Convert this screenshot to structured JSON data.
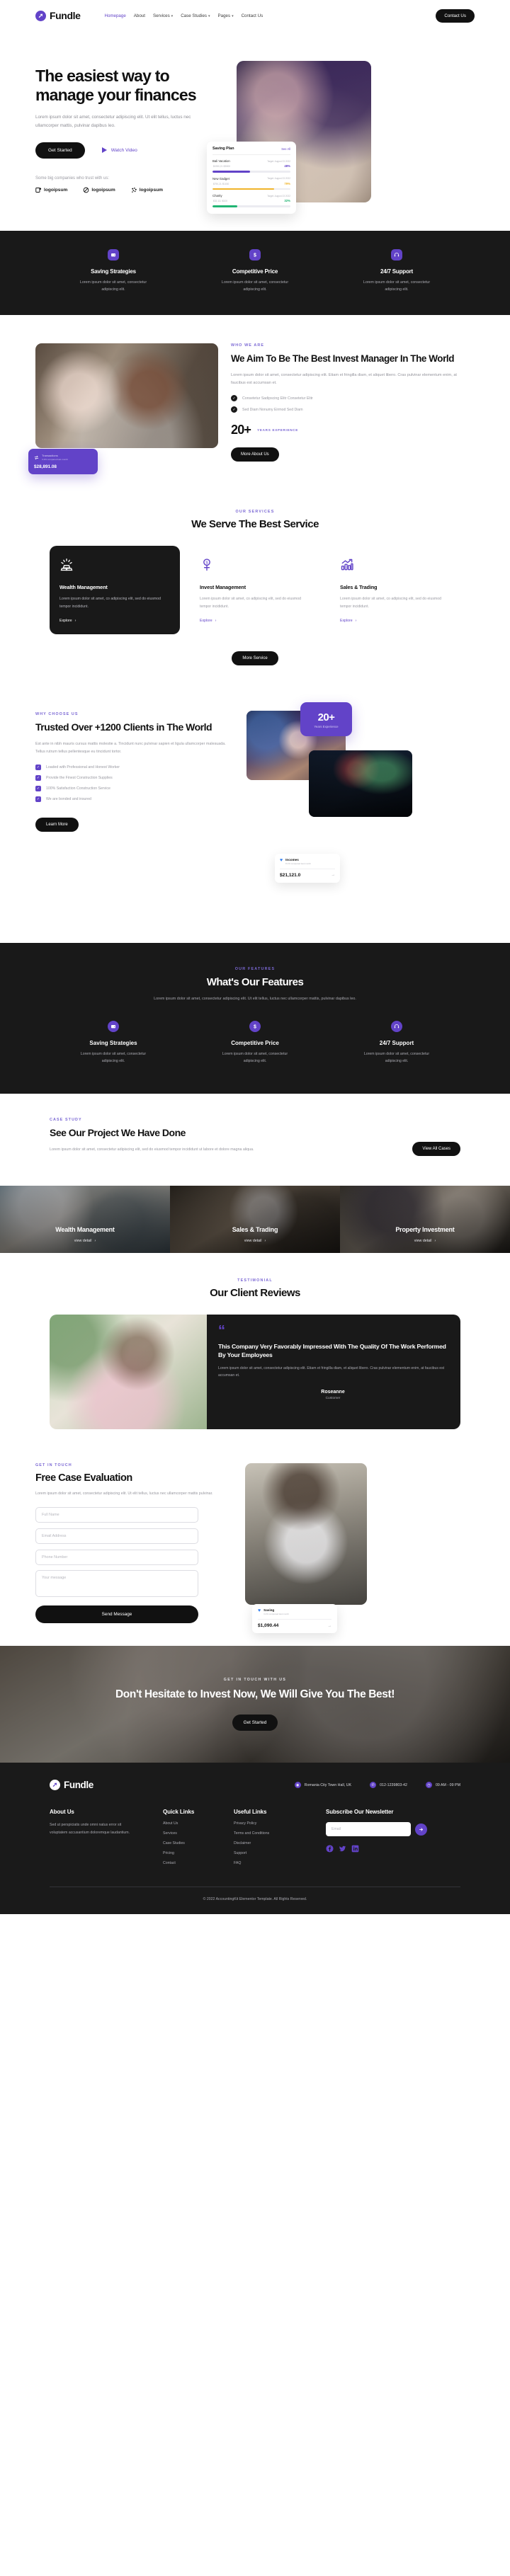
{
  "header": {
    "brand": "Fundle",
    "nav": [
      {
        "label": "Homepage",
        "active": true,
        "caret": false
      },
      {
        "label": "About",
        "active": false,
        "caret": false
      },
      {
        "label": "Services",
        "active": false,
        "caret": true
      },
      {
        "label": "Case Studies",
        "active": false,
        "caret": true
      },
      {
        "label": "Pages",
        "active": false,
        "caret": true
      },
      {
        "label": "Contact Us",
        "active": false,
        "caret": false
      }
    ],
    "cta_label": "Contact Us"
  },
  "hero": {
    "title": "The easiest way to manage your finances",
    "subtitle": "Lorem ipsum dolor sit amet, consectetur adipiscing elit. Ut elit tellus, luctus nec ullamcorper mattis, pulvinar dapibus leo.",
    "primary_btn": "Get Started",
    "secondary_btn": "Watch Video",
    "trust_label": "Some big companies who trust with us:",
    "logos": [
      "logoipsum",
      "logoipsum",
      "logoipsum"
    ],
    "saving_card": {
      "title": "Saving Plan",
      "see_all": "See All",
      "rows": [
        {
          "name": "Bali Vacation",
          "target": "Target: August 23 2022",
          "amount": "$1950,21",
          "denom": "/$5000",
          "pct": "48%",
          "color": "#6243c8",
          "fill": 48
        },
        {
          "name": "New Gadget",
          "target": "Target: August 23 2022",
          "amount": "$790,21",
          "denom": "/$1000",
          "pct": "79%",
          "color": "#f0b429",
          "fill": 79
        },
        {
          "name": "Charity",
          "target": "Target: August 23 2022",
          "amount": "$32,111",
          "denom": "/$100",
          "pct": "32%",
          "color": "#21b573",
          "fill": 32
        }
      ]
    }
  },
  "strip_features": [
    {
      "icon": "wallet-icon",
      "title": "Saving Strategies",
      "desc": "Lorem ipsum dolor sit amet, consectetur adipiscing elit."
    },
    {
      "icon": "dollar-icon",
      "title": "Competitive Price",
      "desc": "Lorem ipsum dolor sit amet, consectetur adipiscing elit."
    },
    {
      "icon": "headset-icon",
      "title": "24/7 Support",
      "desc": "Lorem ipsum dolor sit amet, consectetur adipiscing elit."
    }
  ],
  "about": {
    "eyebrow": "WHO WE ARE",
    "title": "We Aim To Be The Best Invest Manager In The World",
    "desc": "Lorem ipsum dolor sit amet, consectetur adipiscing elit. Etiam et fringilla diam, et aliquet libero. Cras pulvinar elementum enim, at faucibus est accumsan et.",
    "checks": [
      "Consetetur Sadipscing Elitr Consetetur Elitr",
      "Sed Diam Nonumy Eirmod Sed Diam"
    ],
    "stat_number": "20+",
    "stat_label": "YEARS EXPERIENCE",
    "button": "More About Us",
    "chip": {
      "label": "Transactions",
      "sub": "3.2% compared last month",
      "amount": "$28,891.08"
    }
  },
  "services": {
    "eyebrow": "OUR SERVICES",
    "title": "We Serve The Best Service",
    "cards": [
      {
        "icon": "gold-bars-icon",
        "title": "Wealth Management",
        "desc": "Lorem ipsum dolor sit amet, co adipiscing elit, sed do eiusmod tempor incididunt.",
        "link": "Explore",
        "dark": true
      },
      {
        "icon": "money-tree-icon",
        "title": "Invest Management",
        "desc": "Lorem ipsum dolor sit amet, co adipiscing elit, sed do eiusmod tempor incididunt.",
        "link": "Explore",
        "dark": false
      },
      {
        "icon": "bar-chart-up-icon",
        "title": "Sales & Trading",
        "desc": "Lorem ipsum dolor sit amet, co adipiscing elit, sed do eiusmod tempor incididunt.",
        "link": "Explore",
        "dark": false
      }
    ],
    "more_button": "More Service"
  },
  "why": {
    "eyebrow": "WHY CHOOSE US",
    "title": "Trusted Over +1200 Clients in The World",
    "desc": "Est ante in nibh mauris cursus mattis molestie a. Tincidunt nunc pulvinar sapien et ligula ullamcorper malesuada. Tellus rutrum tellus pellentesque eu tincidunt tortor.",
    "checks": [
      "Loaded with Professional and Honest Worker",
      "Provide the Finest Construction Supplies",
      "100% Satisfaction Construction Service",
      "We are bonded and insured"
    ],
    "button": "Learn More",
    "badge_number": "20+",
    "badge_label": "Years Experience",
    "income_card": {
      "name": "Incomes",
      "sub": "8.1% compared last month",
      "amount": "$21,121.0"
    }
  },
  "features": {
    "eyebrow": "OUR FEATURES",
    "title": "What's Our Features",
    "desc": "Lorem ipsum dolor sit amet, consectetur adipiscing elit. Ut elit tellus, luctus nec ullamcorper mattis, pulvinar dapibus leo.",
    "items": [
      {
        "icon": "wallet-icon",
        "title": "Saving Strategies",
        "desc": "Lorem ipsum dolor sit amet, consectetur adipiscing elit."
      },
      {
        "icon": "dollar-icon",
        "title": "Competitive Price",
        "desc": "Lorem ipsum dolor sit amet, consectetur adipiscing elit."
      },
      {
        "icon": "headset-icon",
        "title": "24/7 Support",
        "desc": "Lorem ipsum dolor sit amet, consectetur adipiscing elit."
      }
    ]
  },
  "case_study": {
    "eyebrow": "CASE STUDY",
    "title": "See Our Project We Have Done",
    "desc": "Lorem ipsum dolor sit amet, consectetur adipiscing elit, sed do eiusmod tempor incididunt ut labore et dolore magna aliqua.",
    "button": "View All Cases",
    "tiles": [
      {
        "title": "Wealth Management",
        "link": "view detail"
      },
      {
        "title": "Sales & Trading",
        "link": "view detail"
      },
      {
        "title": "Property Investment",
        "link": "view detail"
      }
    ]
  },
  "testimonial": {
    "eyebrow": "TESTIMONIAL",
    "title": "Our Client Reviews",
    "quote_title": "This Company Very Favorably Impressed With The Quality Of The Work Performed By Your Employees",
    "quote_body": "Lorem ipsum dolor sit amet, consectetur adipiscing elit. Etiam et fringilla diam, et aliquet libero. Cras pulvinar elementum enim, at faucibus est accumsan et.",
    "author": "Roseanne",
    "role": "Customer"
  },
  "contact": {
    "eyebrow": "GET IN TOUCH",
    "title": "Free Case Evaluation",
    "desc": "Lorem ipsum dolor sit amet, consectetur adipiscing elit. Ut elit tellus, luctus nec ullamcorper mattis pulvinar.",
    "fields": {
      "name_placeholder": "Full Name",
      "email_placeholder": "Email Address",
      "phone_placeholder": "Phone Number",
      "message_placeholder": "Your message"
    },
    "submit": "Send Message",
    "saving_mini": {
      "name": "Saving",
      "sub": "3.2% compared last month",
      "amount": "$1,090.44"
    }
  },
  "cta": {
    "eyebrow": "GET IN TOUCH WITH US",
    "title": "Don't Hesitate to Invest Now, We Will Give You The Best!",
    "button": "Get Started"
  },
  "footer": {
    "brand": "Fundle",
    "contacts": [
      {
        "icon": "location-pin-icon",
        "text": "Romania City Town Hall, UK"
      },
      {
        "icon": "phone-icon",
        "text": "012-1239803-42"
      },
      {
        "icon": "clock-icon",
        "text": "09 AM - 09 PM"
      }
    ],
    "about": {
      "title": "About Us",
      "text": "Sed ut perspiciatis unde omni natus error sit voluptatem accusantium doloremque laudantium."
    },
    "quick_links": {
      "title": "Quick Links",
      "items": [
        "About Us",
        "Services",
        "Case Studies",
        "Pricing",
        "Contact"
      ]
    },
    "useful_links": {
      "title": "Useful Links",
      "items": [
        "Privacy Policy",
        "Terms and Conditions",
        "Disclaimer",
        "Support",
        "FAQ"
      ]
    },
    "newsletter": {
      "title": "Subscribe Our Newsletter",
      "placeholder": "Email",
      "button_icon": "arrow-right-icon"
    },
    "socials": [
      "facebook-icon",
      "twitter-icon",
      "linkedin-icon"
    ],
    "copyright": "© 2022 AccountingKit Elementor Template. All Rights Reserved."
  },
  "colors": {
    "accent": "#6243c8",
    "dark": "#191919",
    "muted": "#9a9aa2"
  }
}
